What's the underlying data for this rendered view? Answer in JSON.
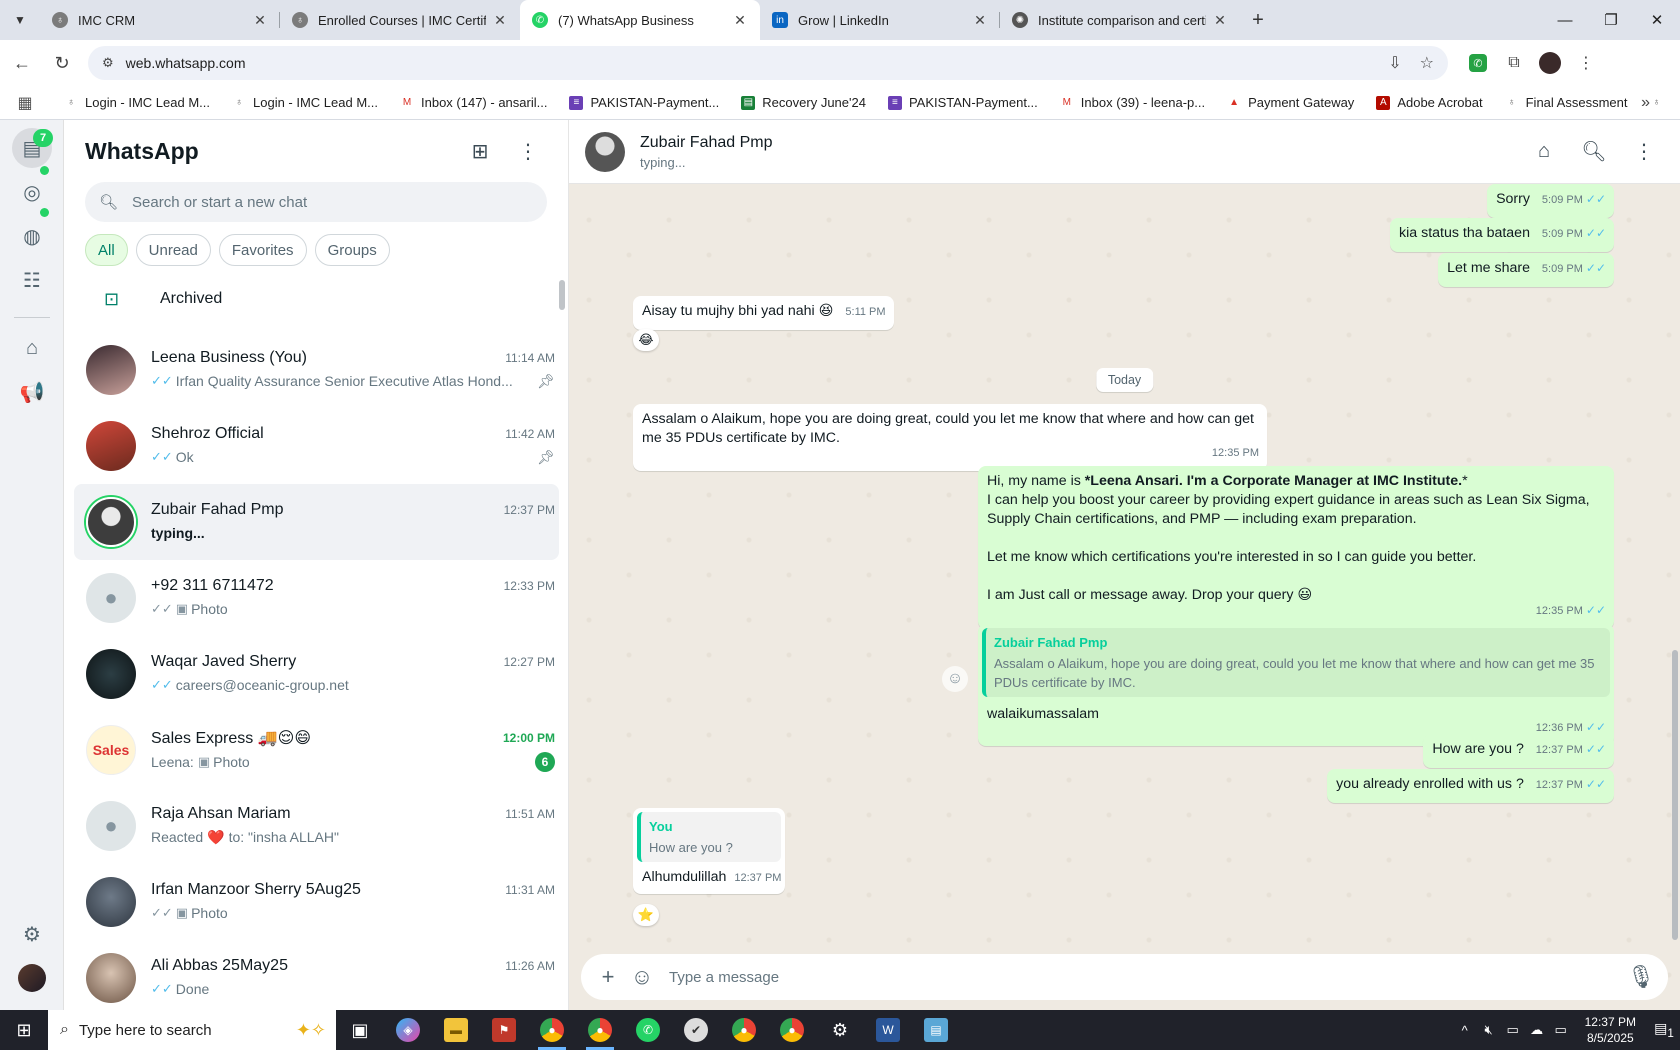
{
  "browser": {
    "tabs": [
      {
        "title": "IMC CRM",
        "active": false
      },
      {
        "title": "Enrolled Courses | IMC Certifica",
        "active": false
      },
      {
        "title": "(7) WhatsApp Business",
        "active": true
      },
      {
        "title": "Grow | LinkedIn",
        "active": false
      },
      {
        "title": "Institute comparison and certifi",
        "active": false
      }
    ],
    "url": "web.whatsapp.com",
    "bookmarks": [
      "Login - IMC Lead M...",
      "Login - IMC Lead M...",
      "Inbox (147) - ansaril...",
      "PAKISTAN-Payment...",
      "Recovery June'24",
      "PAKISTAN-Payment...",
      "Inbox (39) - leena-p...",
      "Payment Gateway",
      "Adobe Acrobat",
      "Final Assessment"
    ]
  },
  "rail": {
    "chats_badge": "7"
  },
  "sidebar": {
    "title": "WhatsApp",
    "search_placeholder": "Search or start a new chat",
    "filters": [
      "All",
      "Unread",
      "Favorites",
      "Groups"
    ],
    "archived_label": "Archived",
    "chats": [
      {
        "name": "Leena Business (You)",
        "time": "11:14 AM",
        "preview": "Irfan Quality Assurance Senior Executive Atlas Hond...",
        "tick": "blue",
        "pinned": true
      },
      {
        "name": "Shehroz Official",
        "time": "11:42 AM",
        "preview": "Ok",
        "tick": "blue",
        "pinned": true
      },
      {
        "name": "Zubair Fahad Pmp",
        "time": "12:37 PM",
        "preview": "typing...",
        "typing": true,
        "selected": true
      },
      {
        "name": "+92 311 6711472",
        "time": "12:33 PM",
        "preview": "Photo",
        "tick": "grey",
        "photo": true
      },
      {
        "name": "Waqar Javed Sherry",
        "time": "12:27 PM",
        "preview": "careers@oceanic-group.net",
        "tick": "blue"
      },
      {
        "name": "Sales Express 🚚😌😄",
        "time": "12:00 PM",
        "preview_prefix": "Leena:",
        "preview": "Photo",
        "photo": true,
        "unread": "6"
      },
      {
        "name": "Raja Ahsan Mariam",
        "time": "11:51 AM",
        "preview_prefix": "Reacted",
        "preview_heart": "❤️",
        "preview": "to: \"insha ALLAH\""
      },
      {
        "name": "Irfan Manzoor Sherry 5Aug25",
        "time": "11:31 AM",
        "preview": "Photo",
        "tick": "grey",
        "photo": true
      },
      {
        "name": "Ali Abbas 25May25",
        "time": "11:26 AM",
        "preview": "Done",
        "tick": "blue"
      }
    ]
  },
  "conversation": {
    "name": "Zubair Fahad Pmp",
    "status": "typing...",
    "date_divider": "Today",
    "messages": {
      "m1": {
        "text": "Sorry",
        "time": "5:09 PM"
      },
      "m2": {
        "text": "kia status tha bataen",
        "time": "5:09 PM"
      },
      "m3": {
        "text": "Let me share",
        "time": "5:09 PM"
      },
      "m4": {
        "text": "Aisay tu mujhy bhi yad nahi 😆",
        "time": "5:11 PM",
        "reaction": "😂"
      },
      "m5": {
        "text": "Assalam o Alaikum, hope you are doing great, could you let me know that where and how can get me 35 PDUs certificate by IMC.",
        "time": "12:35 PM"
      },
      "m6": {
        "intro": "Hi, my name is ",
        "bold": "*Leena Ansari. I'm a Corporate Manager at IMC Institute.",
        "bold_end": "*",
        "line2": "I can help you boost your career by providing expert guidance in areas such as Lean Six Sigma, Supply Chain certifications, and PMP — including exam preparation.",
        "line3": "Let me know which certifications you're interested in so I can guide you better.",
        "line4": "I am Just call or message away. Drop your query 😃",
        "time": "12:35 PM"
      },
      "m7": {
        "quote_author": "Zubair Fahad Pmp",
        "quote_text": "Assalam o Alaikum, hope you are doing great, could you let me know that where and how can get me 35 PDUs certificate by IMC.",
        "text": "walaikumassalam",
        "time": "12:36 PM"
      },
      "m8": {
        "text": "How are you ?",
        "time": "12:37 PM"
      },
      "m9": {
        "text": "you already enrolled with us ?",
        "time": "12:37 PM"
      },
      "m10": {
        "quote_author": "You",
        "quote_text": "How are you ?",
        "text": "Alhumdulillah",
        "time": "12:37 PM",
        "reaction": "⭐"
      }
    },
    "composer_placeholder": "Type a message"
  },
  "taskbar": {
    "search_placeholder": "Type here to search",
    "time": "12:37 PM",
    "date": "8/5/2025",
    "notification_count": "1"
  }
}
